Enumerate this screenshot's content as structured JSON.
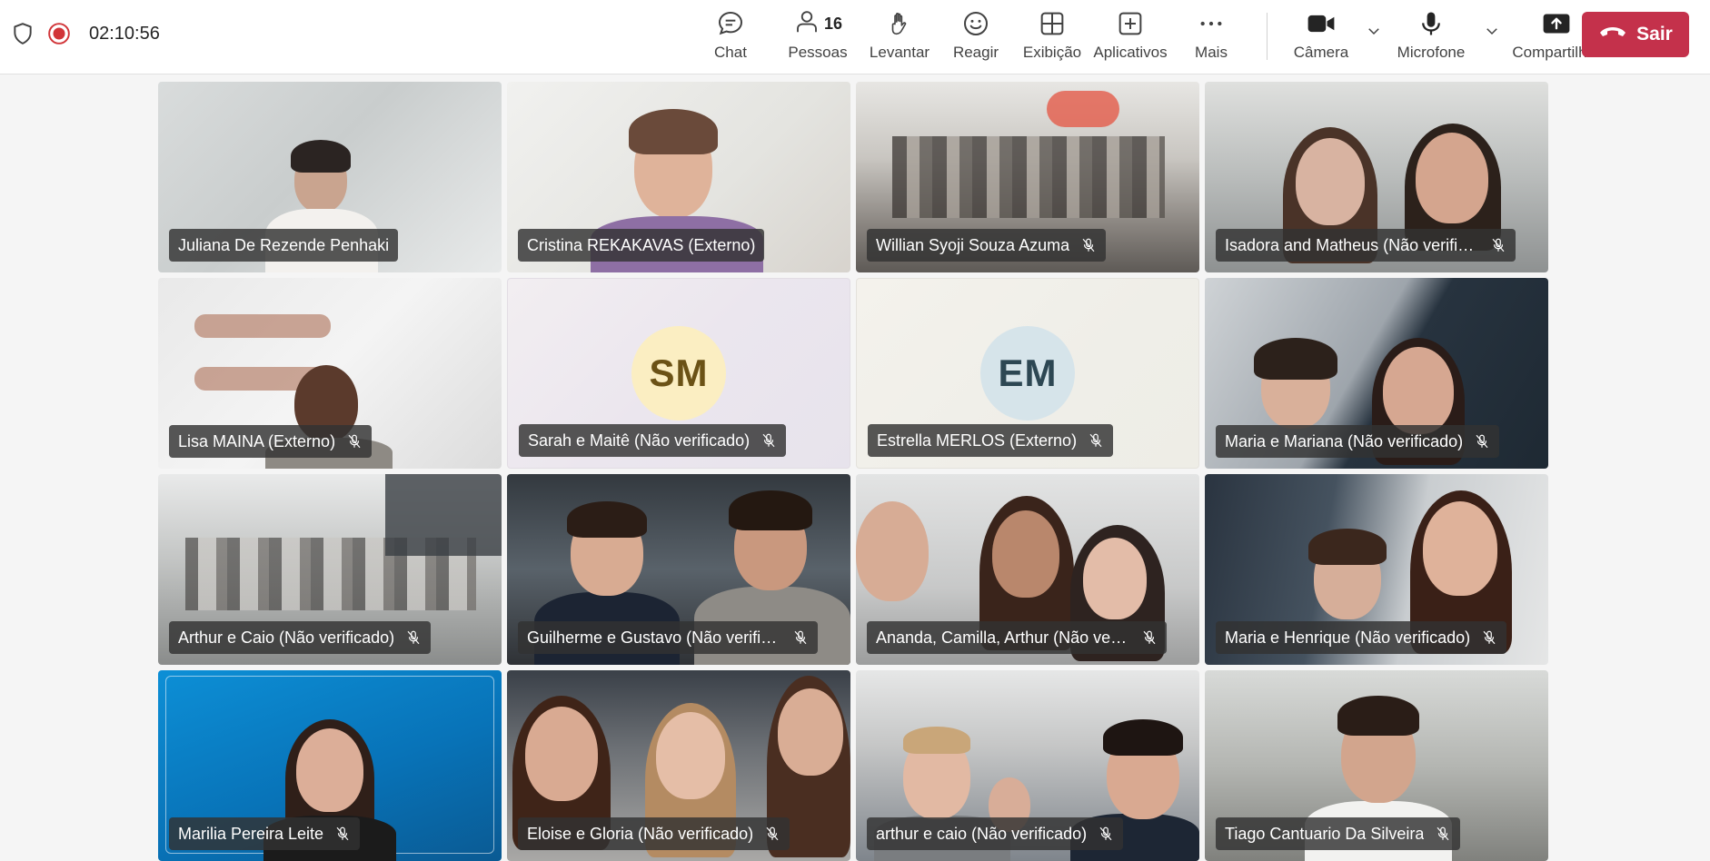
{
  "status": {
    "timer": "02:10:56"
  },
  "toolbar": {
    "chat": "Chat",
    "people": "Pessoas",
    "people_count": "16",
    "raise": "Levantar",
    "react": "Reagir",
    "view": "Exibição",
    "apps": "Aplicativos",
    "more": "Mais",
    "camera": "Câmera",
    "mic": "Microfone",
    "share": "Compartilhar",
    "leave": "Sair"
  },
  "colors": {
    "leave": "#c4314b",
    "recording": "#d13438",
    "sm_avatar": "#fbeec2",
    "em_avatar": "#d6e4ea"
  },
  "participants": [
    {
      "name": "Juliana De Rezende Penhaki",
      "muted": false
    },
    {
      "name": "Cristina REKAKAVAS (Externo)",
      "muted": false
    },
    {
      "name": "Willian Syoji Souza Azuma",
      "muted": true
    },
    {
      "name": "Isadora and Matheus (Não verifica...",
      "muted": true
    },
    {
      "name": "Lisa MAINA (Externo)",
      "muted": true
    },
    {
      "name": "Sarah e Maitê (Não verificado)",
      "muted": true,
      "initials": "SM"
    },
    {
      "name": "Estrella MERLOS (Externo)",
      "muted": true,
      "initials": "EM"
    },
    {
      "name": "Maria e Mariana (Não verificado)",
      "muted": true
    },
    {
      "name": "Arthur e Caio (Não verificado)",
      "muted": true
    },
    {
      "name": "Guilherme e Gustavo (Não verifica...",
      "muted": true
    },
    {
      "name": "Ananda, Camilla, Arthur (Não verifi...",
      "muted": true
    },
    {
      "name": "Maria e Henrique (Não verificado)",
      "muted": true
    },
    {
      "name": "Marilia Pereira Leite",
      "muted": true
    },
    {
      "name": "Eloise e Gloria (Não verificado)",
      "muted": true
    },
    {
      "name": "arthur e caio (Não verificado)",
      "muted": true
    },
    {
      "name": "Tiago Cantuario Da Silveira",
      "muted": true
    }
  ]
}
